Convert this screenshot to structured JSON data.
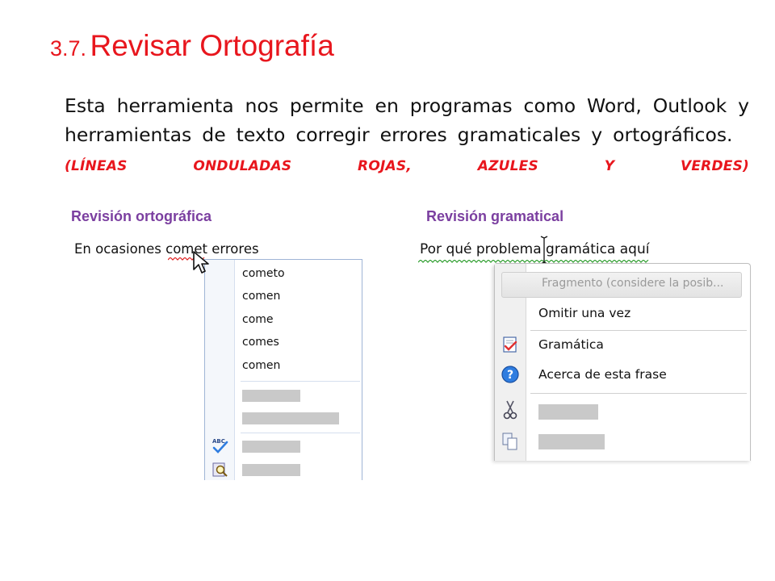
{
  "slide": {
    "title_number": "3.7.",
    "title_text": "Revisar Ortografía",
    "paragraph": "Esta herramienta nos permite en programas como Word, Outlook y herramientas de texto corregir errores gramaticales y ortográficos.",
    "paragraph_note": "(LÍNEAS ONDULADAS ROJAS, AZULES Y VERDES)",
    "accent_color": "#e8161d",
    "caption_color": "#7b3fa0"
  },
  "spell_panel": {
    "caption": "Revisión ortográfica",
    "sentence": "En ocasiones comet errores",
    "underline_color": "#e02020",
    "suggestions": [
      "cometo",
      "comen",
      "come",
      "comes",
      "comen"
    ]
  },
  "grammar_panel": {
    "caption": "Revisión gramatical",
    "sentence": "Por qué problema gramática aquí",
    "underline_color": "#2e9e2e",
    "fragment_label": "Fragmento (considere la posib...",
    "items": {
      "ignore": "Omitir una vez",
      "grammar": "Gramática",
      "about": "Acerca de esta frase"
    }
  }
}
